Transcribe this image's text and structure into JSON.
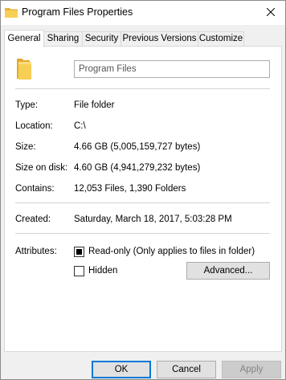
{
  "window": {
    "title": "Program Files Properties",
    "icons": {
      "title": "folder-icon",
      "close": "close-icon"
    }
  },
  "tabs": [
    {
      "label": "General",
      "active": true
    },
    {
      "label": "Sharing",
      "active": false
    },
    {
      "label": "Security",
      "active": false
    },
    {
      "label": "Previous Versions",
      "active": false
    },
    {
      "label": "Customize",
      "active": false
    }
  ],
  "general": {
    "name_value": "Program Files",
    "folder_icon": "folder-icon",
    "type": {
      "label": "Type:",
      "value": "File folder"
    },
    "location": {
      "label": "Location:",
      "value": "C:\\"
    },
    "size": {
      "label": "Size:",
      "value": "4.66 GB (5,005,159,727 bytes)"
    },
    "size_on_disk": {
      "label": "Size on disk:",
      "value": "4.60 GB (4,941,279,232 bytes)"
    },
    "contains": {
      "label": "Contains:",
      "value": "12,053 Files, 1,390 Folders"
    },
    "created": {
      "label": "Created:",
      "value": "Saturday, March 18, 2017, 5:03:28 PM"
    },
    "attributes": {
      "label": "Attributes:",
      "readonly": {
        "label": "Read-only (Only applies to files in folder)",
        "state": "indeterminate"
      },
      "hidden": {
        "label": "Hidden",
        "checked": false
      },
      "advanced_label": "Advanced..."
    }
  },
  "footer": {
    "ok_label": "OK",
    "cancel_label": "Cancel",
    "apply_label": "Apply",
    "apply_enabled": false
  },
  "colors": {
    "folder": "#f4c542",
    "accent": "#0078d7"
  }
}
